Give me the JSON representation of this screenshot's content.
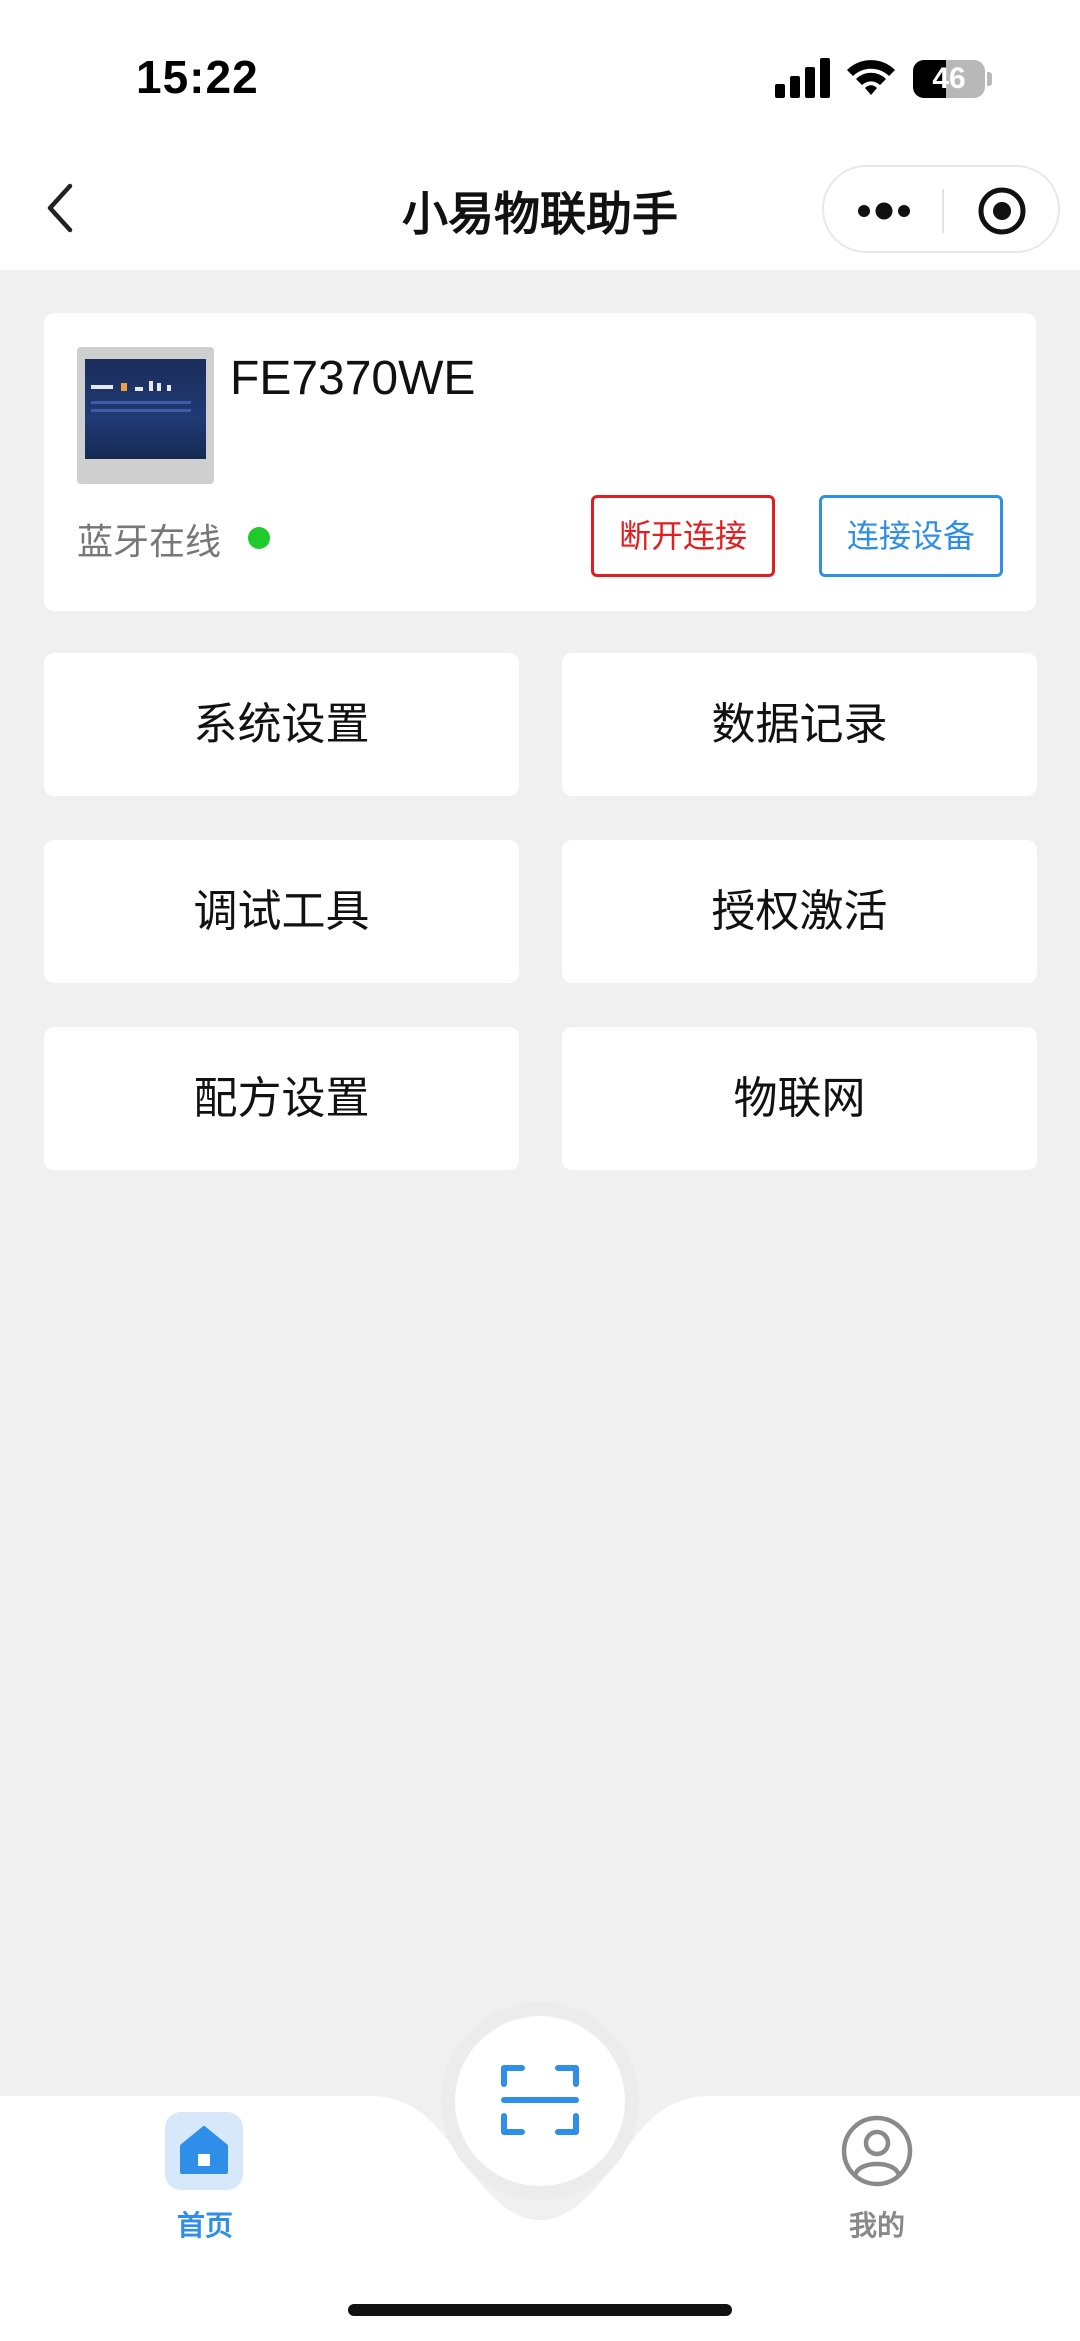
{
  "status_bar": {
    "time": "15:22",
    "battery_percent": "46",
    "icons": [
      "signal-icon",
      "wifi-icon",
      "battery-icon"
    ]
  },
  "nav": {
    "title": "小易物联助手",
    "icons": [
      "back-icon",
      "more-icon",
      "target-icon"
    ]
  },
  "device": {
    "name": "FE7370WE",
    "bluetooth_status": "蓝牙在线",
    "online_color": "#1ecb2b",
    "disconnect_label": "断开连接",
    "connect_label": "连接设备"
  },
  "menu": {
    "items": [
      {
        "label": "系统设置"
      },
      {
        "label": "数据记录"
      },
      {
        "label": "调试工具"
      },
      {
        "label": "授权激活"
      },
      {
        "label": "配方设置"
      },
      {
        "label": "物联网"
      }
    ]
  },
  "tabbar": {
    "home_label": "首页",
    "mine_label": "我的",
    "active_color": "#2f8ee8",
    "inactive_color": "#888888",
    "icons": [
      "home-icon",
      "scan-icon",
      "user-icon"
    ]
  },
  "colors": {
    "background": "#f0f0f0",
    "danger": "#e02020",
    "primary": "#2f8ee8"
  }
}
